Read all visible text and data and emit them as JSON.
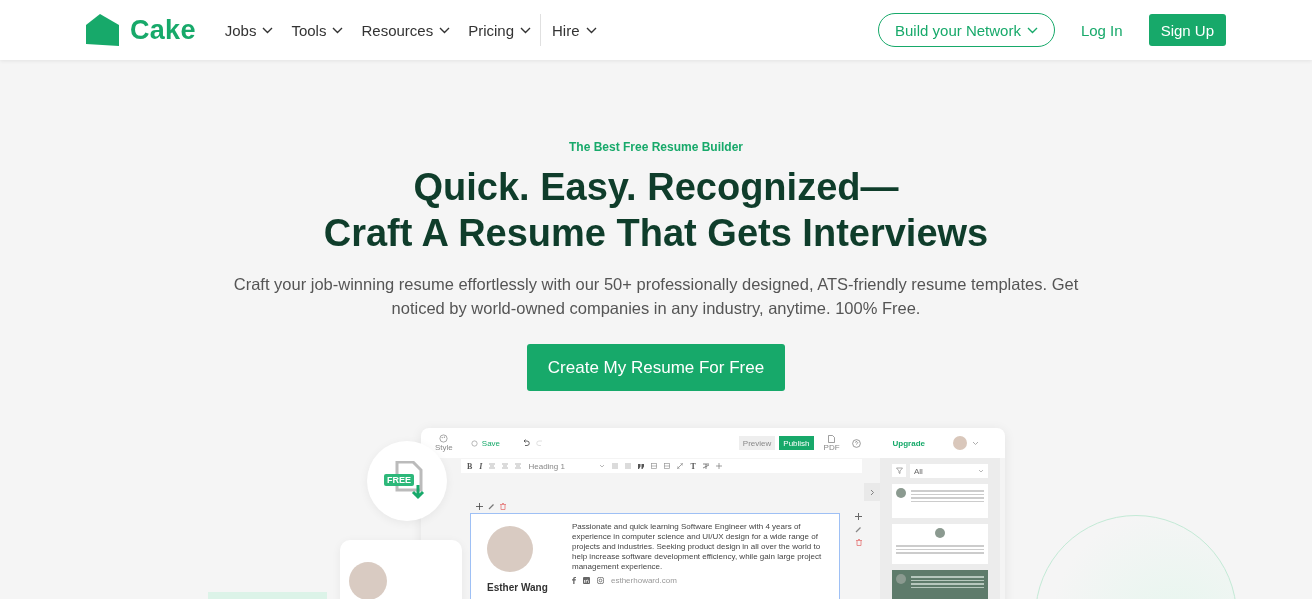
{
  "nav": {
    "logo": "Cake",
    "items": [
      {
        "label": "Jobs",
        "separated": false
      },
      {
        "label": "Tools",
        "separated": false
      },
      {
        "label": "Resources",
        "separated": false
      },
      {
        "label": "Pricing",
        "separated": false
      },
      {
        "label": "Hire",
        "separated": true
      }
    ],
    "network_button": "Build your Network",
    "login": "Log In",
    "signup": "Sign Up"
  },
  "hero": {
    "eyebrow": "The Best Free Resume Builder",
    "title_lines": [
      "Quick. Easy. Recognized—",
      "Craft A Resume That Gets Interviews"
    ],
    "description": "Craft your job-winning resume effortlessly with our 50+ professionally designed, ATS-friendly resume templates. Get noticed by world-owned companies in any industry, anytime. 100% Free.",
    "cta": "Create My Resume For Free"
  },
  "preview": {
    "free_badge": "FREE",
    "style_label": "Style",
    "save": "Save",
    "preview_button": "Preview",
    "publish_button": "Publish",
    "pdf_label": "PDF",
    "upgrade": "Upgrade",
    "toolbar": {
      "bold_key": "B",
      "italic_key": "I",
      "heading_select": "Heading 1",
      "text_key": "T"
    },
    "filter": "All",
    "resume": {
      "name": "Esther Wang",
      "summary": "Passionate and quick learning Software Engineer with 4 years of experience in computer science and UI/UX design for a wide range of projects and industries. Seeking product design in all over the world to help increase software development efficiency, while gain large project management experience.",
      "website": "estherhoward.com"
    },
    "templates": [
      {
        "kind": "light"
      },
      {
        "kind": "centered"
      },
      {
        "kind": "dark"
      }
    ]
  }
}
